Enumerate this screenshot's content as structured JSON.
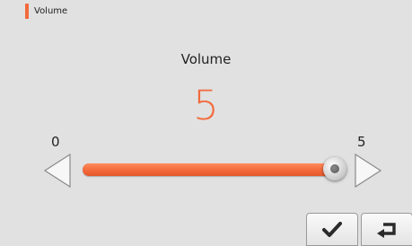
{
  "header": {
    "title": "Volume",
    "accent_color": "#f26a3b"
  },
  "setting": {
    "label": "Volume",
    "value": "5",
    "value_color": "#f26a3b"
  },
  "slider": {
    "min_label": "0",
    "max_label": "5",
    "min": 0,
    "max": 5,
    "current": 5
  },
  "controls": {
    "decrease_icon": "triangle-left-icon",
    "increase_icon": "triangle-right-icon",
    "confirm_icon": "checkmark-icon",
    "back_icon": "return-arrow-icon"
  }
}
